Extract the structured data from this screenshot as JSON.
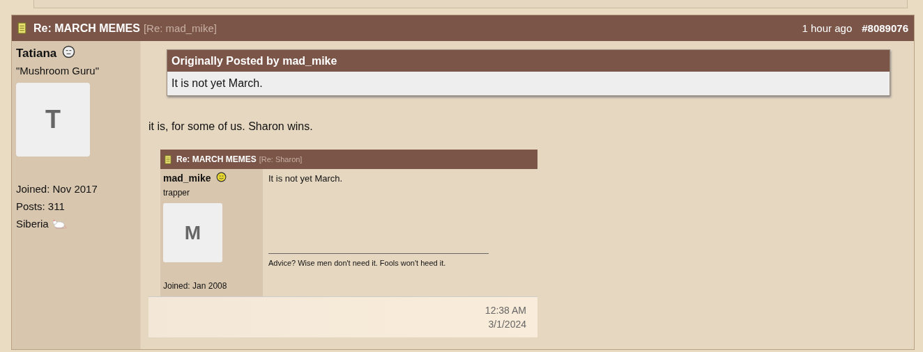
{
  "post": {
    "title": "Re: MARCH MEMES",
    "subtitle": "[Re: mad_mike]",
    "time": "1 hour ago",
    "number": "#8089076",
    "author": {
      "name": "Tatiana",
      "title": "\"Mushroom Guru\"",
      "avatar_letter": "T",
      "joined": "Joined: Nov 2017",
      "posts": "Posts: 311",
      "location": "Siberia"
    },
    "quote": {
      "heading": "Originally Posted by mad_mike",
      "text": "It is not yet March."
    },
    "body": "it is, for some of us. Sharon wins.",
    "screenshot": {
      "title": "Re: MARCH MEMES",
      "subtitle": "[Re: Sharon]",
      "author": {
        "name": "mad_mike",
        "title": "trapper",
        "avatar_letter": "M",
        "joined": "Joined: Jan 2008"
      },
      "text": "It is not yet March.",
      "signature": "Advice? Wise men don't need it. Fools won't heed it.",
      "time": "12:38 AM",
      "date": "3/1/2024"
    }
  }
}
